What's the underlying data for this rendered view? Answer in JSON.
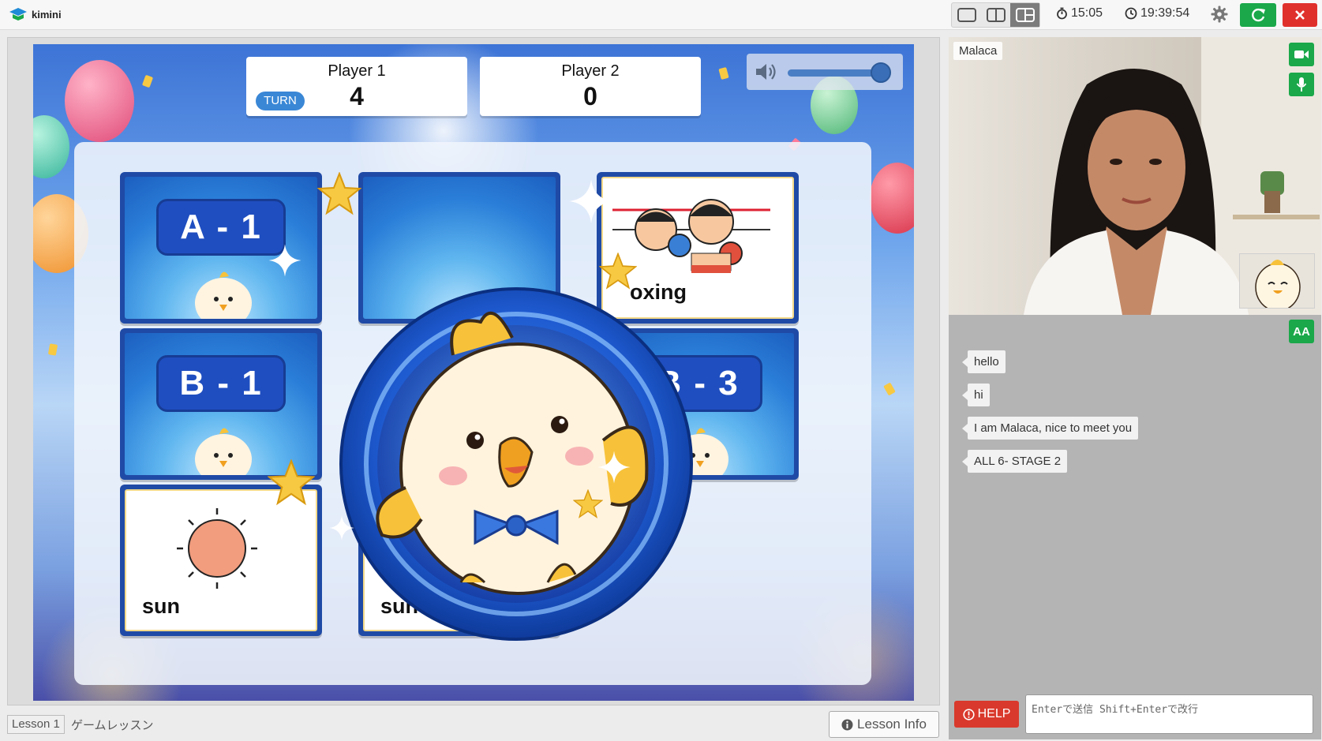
{
  "app": {
    "name": "kimini"
  },
  "timers": {
    "lesson_timer": "15:05",
    "clock": "19:39:54"
  },
  "colors": {
    "accent_green": "#1aa84a",
    "close_red": "#e0302c",
    "card_blue": "#1f4aa6"
  },
  "game": {
    "player1": {
      "name": "Player 1",
      "score": "4",
      "turn_label": "TURN"
    },
    "player2": {
      "name": "Player 2",
      "score": "0"
    },
    "volume_level": 0.95,
    "cards": [
      {
        "label": "A - 1",
        "face_down": true
      },
      {
        "label": "",
        "face_down": true
      },
      {
        "word": "oxing",
        "image": "boxing-icon",
        "face_down": false
      },
      {
        "label": "B - 1",
        "face_down": true
      },
      {
        "label": "B - 3",
        "face_down": true
      },
      {
        "word": "sun",
        "image": "sun-icon",
        "face_down": false
      },
      {
        "word": "sun",
        "image": "sun-icon",
        "face_down": false
      }
    ]
  },
  "footer": {
    "lesson": "Lesson 1",
    "lesson_type": "ゲームレッスン",
    "info_button": "Lesson Info"
  },
  "video": {
    "participant_name": "Malaca"
  },
  "chat": {
    "messages": [
      "hello",
      "hi",
      "I am Malaca, nice to meet you",
      "ALL 6- STAGE 2"
    ],
    "help_label": "HELP",
    "placeholder": "Enterで送信 Shift+Enterで改行",
    "font_toggle": "AA"
  }
}
